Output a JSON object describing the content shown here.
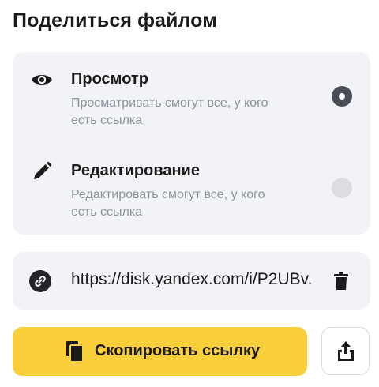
{
  "header": {
    "title": "Поделиться файлом"
  },
  "access_options": [
    {
      "icon": "eye-icon",
      "title": "Просмотр",
      "description": "Просматривать смогут все, у кого есть ссылка",
      "selected": true
    },
    {
      "icon": "pencil-icon",
      "title": "Редактирование",
      "description": "Редактировать смогут все, у кого есть ссылка",
      "selected": false
    }
  ],
  "link": {
    "icon": "link-icon",
    "url": "https://disk.yandex.com/i/P2UBv.",
    "delete_icon": "trash-icon"
  },
  "actions": {
    "copy_label": "Скопировать ссылку",
    "copy_icon": "copy-icon",
    "share_icon": "share-icon"
  },
  "colors": {
    "accent": "#f9d03b",
    "card_background": "#f2f3f6",
    "secondary_text": "#8e929c",
    "primary_text": "#1b1b1b"
  }
}
